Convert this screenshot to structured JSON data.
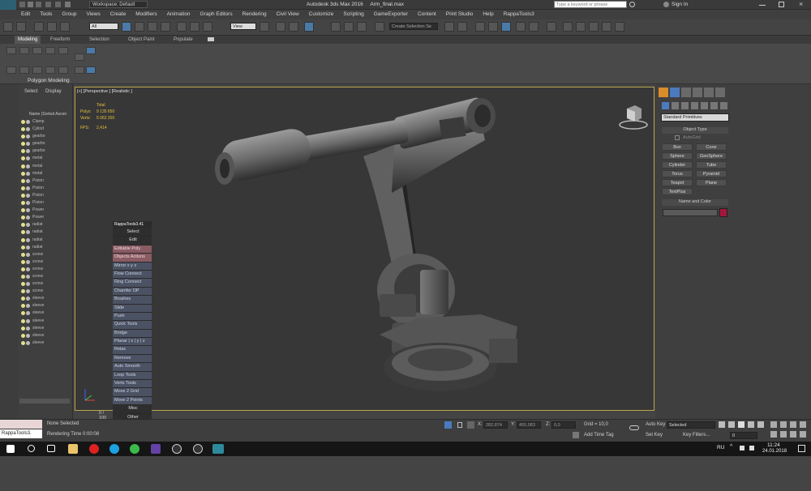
{
  "app": {
    "logo_label": "MAX",
    "title": "Autodesk 3ds Max 2016     Arm_final.max",
    "workspace": "Workspace: Default",
    "search_placeholder": "Type a keyword or phrase",
    "sign_in": "Sign In"
  },
  "menu": [
    "Edit",
    "Tools",
    "Group",
    "Views",
    "Create",
    "Modifiers",
    "Animation",
    "Graph Editors",
    "Rendering",
    "Civil View",
    "Customize",
    "Scripting",
    "GameExporter",
    "Content",
    "Print Studio",
    "Help",
    "RappaTools3"
  ],
  "toolbar": {
    "selection_filter": "All",
    "ref_coord": "View",
    "named_selection": "Create Selection Se",
    "snap_label": "3"
  },
  "ribbon": {
    "tabs": [
      "Modeling",
      "Freeform",
      "Selection",
      "Object Paint",
      "Populate"
    ],
    "panel_title": "Polygon Modeling"
  },
  "explorer": {
    "tab_select": "Select",
    "tab_display": "Display",
    "column_header": "Name (Sorted Ascen",
    "items": [
      "Clamp",
      "Cylind",
      "gearbo",
      "gearbo",
      "gearbo",
      "metal",
      "metal",
      "metal",
      "Piston",
      "Piston",
      "Piston",
      "Piston",
      "Power",
      "Power",
      "radiat",
      "radiat",
      "radiat",
      "radiat",
      "screw",
      "screw",
      "screw",
      "screw",
      "screw",
      "screw",
      "sleeve",
      "sleeve",
      "sleeve",
      "sleeve",
      "sleeve",
      "sleeve",
      "sleeve"
    ],
    "scroll_status": "0 / 100"
  },
  "viewport": {
    "label": "[+] [Perspective ] [Realistic ]",
    "stats": {
      "header": "Total",
      "polys_label": "Polys:",
      "polys": "9 135 650",
      "verts_label": "Verts:",
      "verts": "5 062 200",
      "fps_label": "FPS:",
      "fps": "2,414"
    }
  },
  "rappa": {
    "title": "RappaTools3.41",
    "items": [
      "Select",
      "Edit",
      "Editable Poly",
      "Objects Actions",
      "Mirror   x  y  z",
      "Flow Connect",
      "Ring Connect",
      "Chamfer OP",
      "Brushes",
      "Slide",
      "Push",
      "Quick Tools",
      "Bridge",
      "Planar | x | y | z",
      "Relax",
      "Remove",
      "Auto Smooth",
      "Loop Tools",
      "Verts Tools",
      "Move 2 Grid",
      "Move 2 Points",
      "Misc",
      "Other"
    ]
  },
  "command_panel": {
    "category": "Standard Primitives",
    "object_type_header": "Object Type",
    "autogrid": "AutoGrid",
    "primitives": [
      "Box",
      "Cone",
      "Sphere",
      "GeoSphere",
      "Cylinder",
      "Tube",
      "Torus",
      "Pyramid",
      "Teapot",
      "Plane",
      "TextPlus"
    ],
    "name_color_header": "Name and Color",
    "object_color": "#a3163a"
  },
  "status": {
    "script_listener": "RappaTools3.",
    "selection": "None Selected",
    "render_time": "Rendering Time  0:00:08",
    "x_label": "X:",
    "x_value": "282,874",
    "y_label": "Y:",
    "y_value": "455,083",
    "z_label": "Z:",
    "z_value": "0,0",
    "grid": "Grid = 10,0",
    "add_time_tag": "Add Time Tag",
    "auto_key": "Auto Key",
    "set_key": "Set Key",
    "key_mode": "Selected",
    "key_filters": "Key Filters...",
    "frame": "0"
  },
  "taskbar": {
    "lang": "RU",
    "time": "11:24",
    "date": "24.01.2018"
  }
}
